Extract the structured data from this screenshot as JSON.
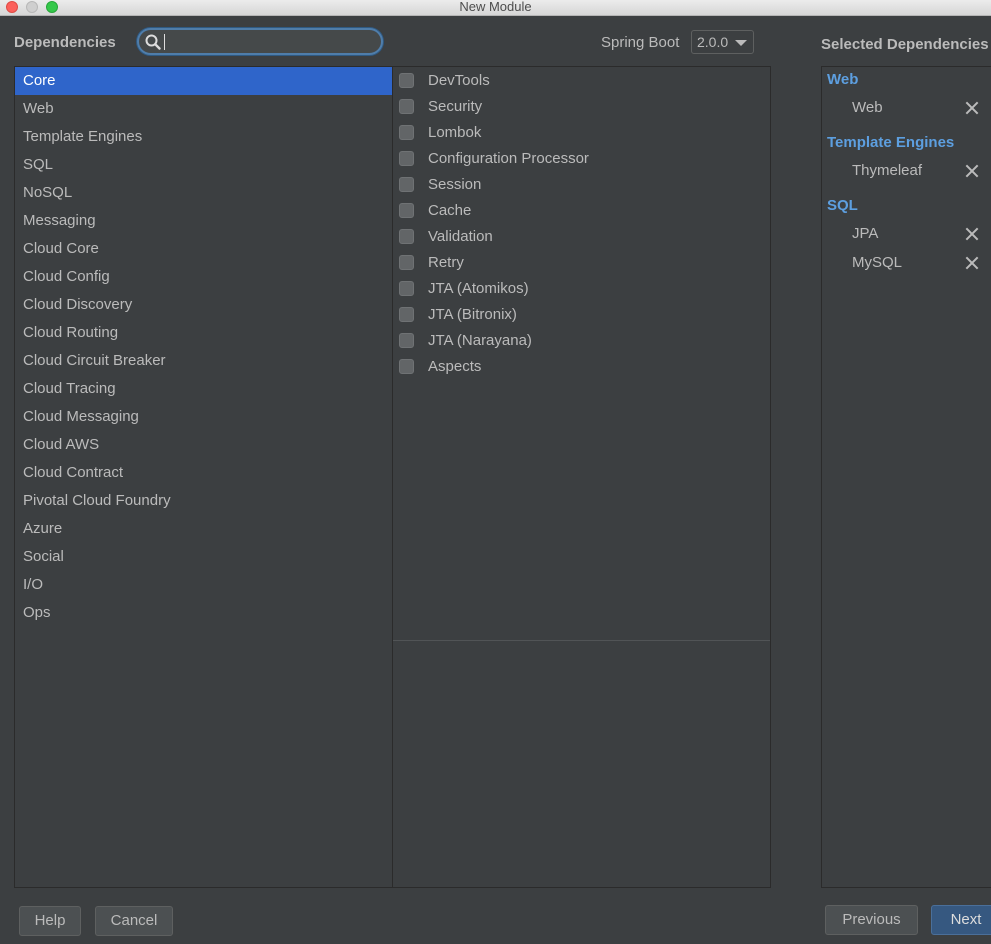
{
  "window": {
    "title": "New Module"
  },
  "header": {
    "dependencies_label": "Dependencies",
    "search_value": "",
    "spring_boot_label": "Spring Boot",
    "spring_boot_version": "2.0.0",
    "selected_label": "Selected Dependencies"
  },
  "categories": [
    "Core",
    "Web",
    "Template Engines",
    "SQL",
    "NoSQL",
    "Messaging",
    "Cloud Core",
    "Cloud Config",
    "Cloud Discovery",
    "Cloud Routing",
    "Cloud Circuit Breaker",
    "Cloud Tracing",
    "Cloud Messaging",
    "Cloud AWS",
    "Cloud Contract",
    "Pivotal Cloud Foundry",
    "Azure",
    "Social",
    "I/O",
    "Ops"
  ],
  "selected_category": "Core",
  "dependencies": [
    "DevTools",
    "Security",
    "Lombok",
    "Configuration Processor",
    "Session",
    "Cache",
    "Validation",
    "Retry",
    "JTA (Atomikos)",
    "JTA (Bitronix)",
    "JTA (Narayana)",
    "Aspects"
  ],
  "selected": [
    {
      "group": "Web",
      "items": [
        "Web"
      ]
    },
    {
      "group": "Template Engines",
      "items": [
        "Thymeleaf"
      ]
    },
    {
      "group": "SQL",
      "items": [
        "JPA",
        "MySQL"
      ]
    }
  ],
  "buttons": {
    "help": "Help",
    "cancel": "Cancel",
    "previous": "Previous",
    "next": "Next"
  },
  "colors": {
    "background": "#3c3f41",
    "selection": "#2f65ca",
    "group_title": "#5d9fe0",
    "next_button": "#365880"
  }
}
